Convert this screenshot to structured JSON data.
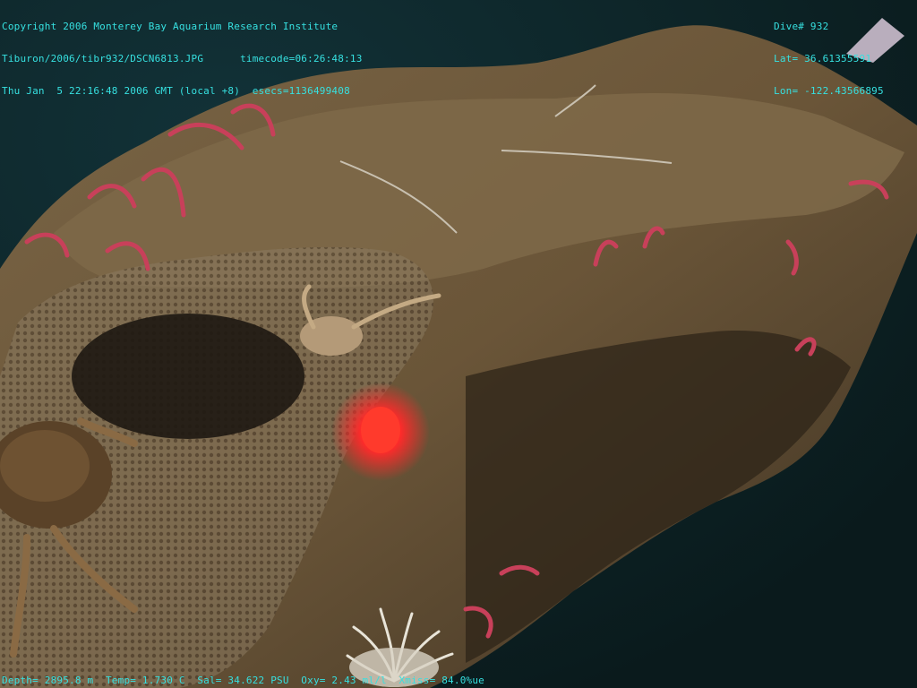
{
  "overlay": {
    "top_left": {
      "line1": "Copyright 2006 Monterey Bay Aquarium Research Institute",
      "line2": "Tiburon/2006/tibr932/DSCN6813.JPG      timecode=06:26:48:13",
      "line3": "Thu Jan  5 22:16:48 2006 GMT (local +8)  esecs=1136499408"
    },
    "top_right": {
      "dive": "Dive# 932",
      "lat": "Lat= 36.61355591",
      "lon": "Lon= -122.43566895"
    },
    "bottom": {
      "sensors": "Depth= 2895.8 m  Temp= 1.730 C  Sal= 34.622 PSU  Oxy= 2.43 ml/l  Xmiss= 84.0%ue"
    }
  },
  "colors": {
    "overlay_text": "#36e0e0",
    "water": "#0b1f22",
    "rock": "#6e5a3e",
    "worm": "#c8405a",
    "glow": "#ff2a2a"
  }
}
